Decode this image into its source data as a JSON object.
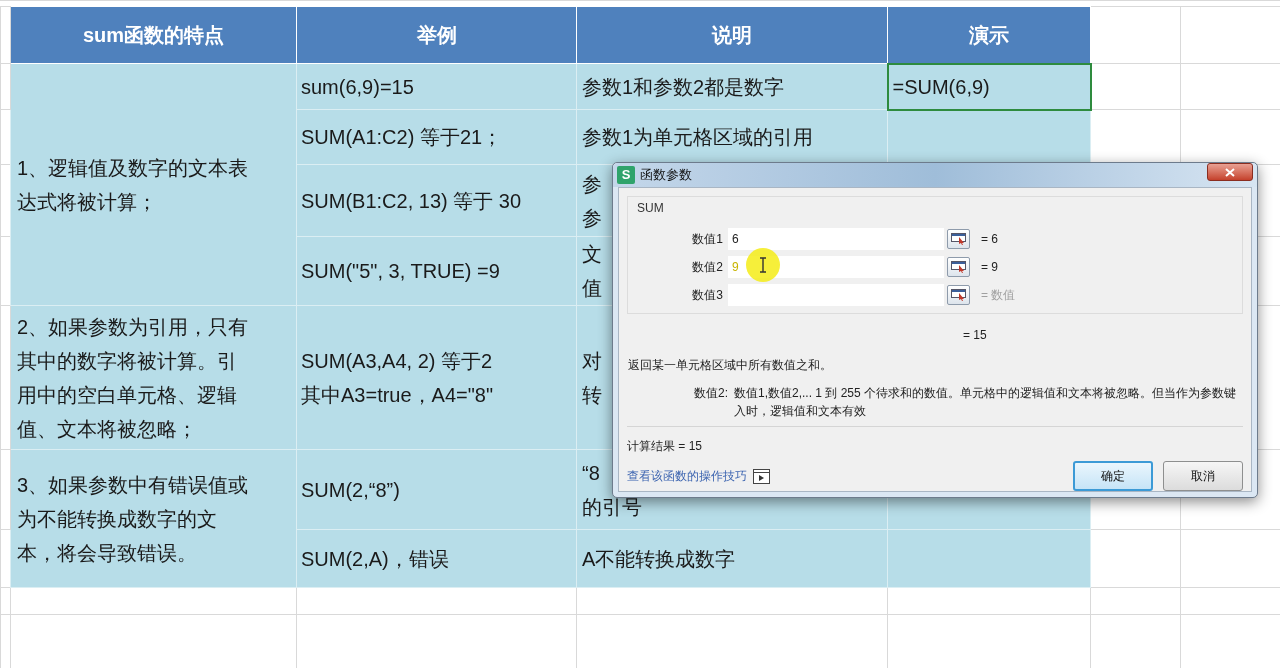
{
  "table": {
    "columns": [
      "sum函数的特点",
      "举例",
      "说明",
      "演示"
    ],
    "groups": [
      {
        "feature": [
          "1、逻辑值及数字的文本表",
          "达式将被计算；"
        ],
        "rows": [
          {
            "example": [
              "sum(6,9)=15"
            ],
            "note": [
              "参数1和参数2都是数字"
            ],
            "demo": "=SUM(6,9)",
            "selected": true
          },
          {
            "example": [
              "SUM(A1:C2) 等于21；"
            ],
            "note": [
              "参数1为单元格区域的引用"
            ],
            "selected": false
          },
          {
            "example": [
              "SUM(B1:C2, 13) 等于 30"
            ],
            "note": [
              "参",
              "参"
            ],
            "selected": false
          },
          {
            "example": [
              "SUM(\"5\", 3, TRUE) =9"
            ],
            "note": [
              "文",
              "值"
            ],
            "selected": false
          }
        ]
      },
      {
        "feature": [
          "2、如果参数为引用，只有",
          "其中的数字将被计算。引",
          "用中的空白单元格、逻辑",
          "值、文本将被忽略；"
        ],
        "rows": [
          {
            "example": [
              "SUM(A3,A4, 2) 等于2",
              "其中A3=true，A4=\"8\""
            ],
            "note": [
              "对",
              "转"
            ],
            "selected": false
          }
        ]
      },
      {
        "feature": [
          "3、如果参数中有错误值或",
          "为不能转换成数字的文",
          "本，将会导致错误。"
        ],
        "rows": [
          {
            "example": [
              "SUM(2,“8”)"
            ],
            "note": [
              "“8",
              "的引号"
            ],
            "selected": false
          },
          {
            "example": [
              "SUM(2,A)，错误"
            ],
            "note": [
              "A不能转换成数字"
            ],
            "selected": false
          }
        ]
      }
    ]
  },
  "dialog": {
    "icon_text": "S",
    "title": "函数参数",
    "function": "SUM",
    "args": [
      {
        "label": "数值1",
        "value": "6",
        "result": "= 6",
        "dimmed": false
      },
      {
        "label": "数值2",
        "value": "9",
        "result": "= 9",
        "dimmed": false
      },
      {
        "label": "数值3",
        "result": "= 数值",
        "dimmed": true
      }
    ],
    "formula_result": "= 15",
    "description": "返回某一单元格区域中所有数值之和。",
    "help_label": "数值2:",
    "help_text": "数值1,数值2,... 1 到 255 个待求和的数值。单元格中的逻辑值和文本将被忽略。但当作为参数键入时，逻辑值和文本有效",
    "calc_result": "计算结果 = 15",
    "link": "查看该函数的操作技巧",
    "buttons": [
      {
        "label": "确定",
        "default": true
      },
      {
        "label": "取消",
        "default": false
      }
    ]
  }
}
